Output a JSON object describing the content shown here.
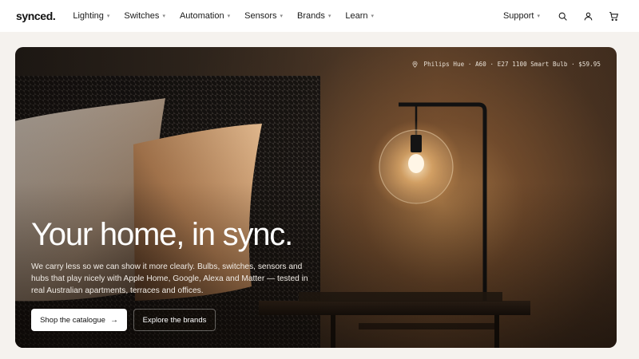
{
  "brand": {
    "logo": "synced."
  },
  "nav": {
    "items": [
      {
        "label": "Lighting"
      },
      {
        "label": "Switches"
      },
      {
        "label": "Automation"
      },
      {
        "label": "Sensors"
      },
      {
        "label": "Brands"
      },
      {
        "label": "Learn"
      }
    ],
    "caret": "▾",
    "support": "Support",
    "icons": [
      "search-icon",
      "account-icon",
      "cart-icon"
    ]
  },
  "hero": {
    "product_tag": "Philips Hue · A60 · E27 1100 Smart Bulb · $59.95",
    "title": "Your home, in sync.",
    "subtitle": "We carry less so we can show it more clearly. Bulbs, switches, sensors and hubs that play nicely with Apple Home, Google, Alexa and Matter — tested in real Australian apartments, terraces and offices.",
    "primary_cta": "Shop the catalogue",
    "primary_cta_arrow": "→",
    "secondary_cta": "Explore the brands"
  },
  "colors": {
    "page_bg": "#f5f2ee",
    "header_bg": "#ffffff",
    "hero_warm_glow": "#eeaa60",
    "text_dark": "#1a1a1a",
    "text_light": "#ffffff"
  }
}
